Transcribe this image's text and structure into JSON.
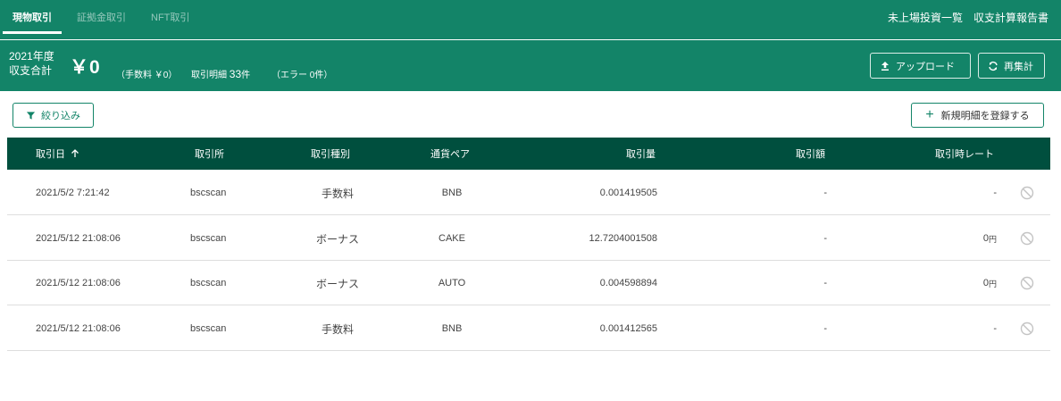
{
  "tabs": [
    "現物取引",
    "証拠金取引",
    "NFT取引"
  ],
  "toplinks": {
    "unlisted": "未上場投資一覧",
    "report": "収支計算報告書"
  },
  "summary": {
    "year": "2021年度",
    "total_label": "収支合計",
    "total_value": "￥0",
    "fee": "（手数料 ￥0）",
    "count_label": "取引明細",
    "count_value": "33",
    "count_unit": "件",
    "errors": "（エラー 0件）"
  },
  "buttons": {
    "upload": "アップロード",
    "recalc": "再集計",
    "filter": "絞り込み",
    "new_entry": "新規明細を登録する"
  },
  "table": {
    "headers": {
      "date": "取引日",
      "exchange": "取引所",
      "type": "取引種別",
      "pair": "通貨ペア",
      "amount": "取引量",
      "value": "取引額",
      "rate": "取引時レート"
    },
    "rows": [
      {
        "date": "2021/5/2 7:21:42",
        "exchange": "bscscan",
        "type": "手数料",
        "pair": "BNB",
        "amount": "0.001419505",
        "value": "-",
        "rate": "-",
        "rate_unit": ""
      },
      {
        "date": "2021/5/12 21:08:06",
        "exchange": "bscscan",
        "type": "ボーナス",
        "pair": "CAKE",
        "amount": "12.7204001508",
        "value": "-",
        "rate": "0",
        "rate_unit": "円"
      },
      {
        "date": "2021/5/12 21:08:06",
        "exchange": "bscscan",
        "type": "ボーナス",
        "pair": "AUTO",
        "amount": "0.004598894",
        "value": "-",
        "rate": "0",
        "rate_unit": "円"
      },
      {
        "date": "2021/5/12 21:08:06",
        "exchange": "bscscan",
        "type": "手数料",
        "pair": "BNB",
        "amount": "0.001412565",
        "value": "-",
        "rate": "-",
        "rate_unit": ""
      }
    ]
  },
  "icons": {
    "sort": "arrow-up-icon",
    "filter": "funnel-icon",
    "upload": "upload-icon",
    "recalc": "refresh-icon",
    "add": "plus-icon",
    "row_action": "ban-icon"
  },
  "colors": {
    "primary": "#138468",
    "header_dark": "#004f3e"
  }
}
